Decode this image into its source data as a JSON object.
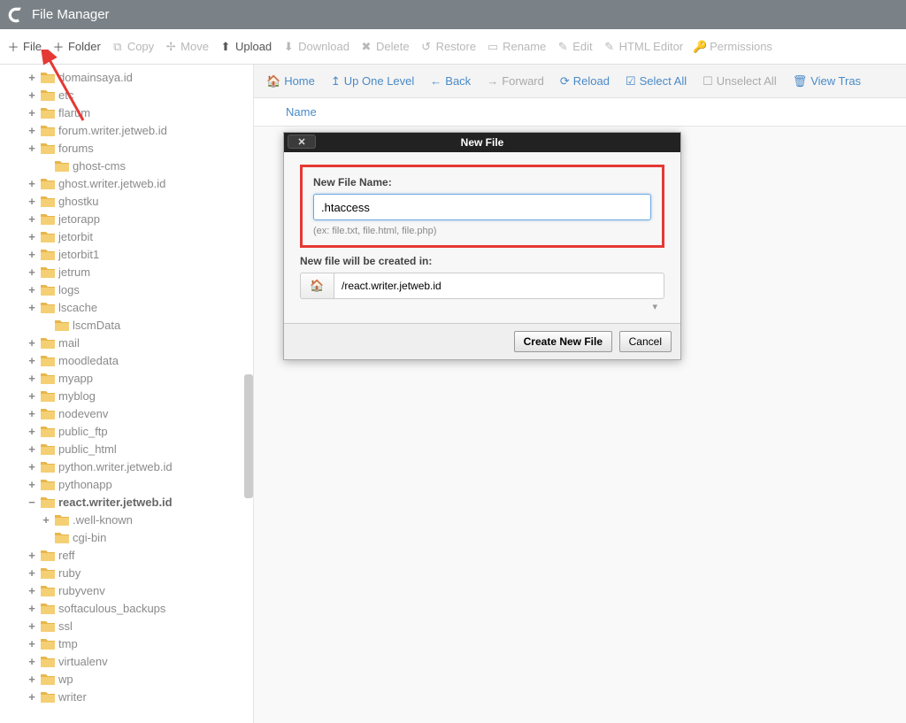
{
  "header": {
    "app_title": "File Manager"
  },
  "toolbar": {
    "file": "File",
    "folder": "Folder",
    "copy": "Copy",
    "move": "Move",
    "upload": "Upload",
    "download": "Download",
    "delete": "Delete",
    "restore": "Restore",
    "rename": "Rename",
    "edit": "Edit",
    "html_editor": "HTML Editor",
    "permissions": "Permissions"
  },
  "actionbar": {
    "home": "Home",
    "up": "Up One Level",
    "back": "Back",
    "forward": "Forward",
    "reload": "Reload",
    "select_all": "Select All",
    "unselect_all": "Unselect All",
    "view_trash": "View Tras"
  },
  "listing": {
    "col_name": "Name"
  },
  "tree": {
    "nodes": [
      {
        "lvl": 1,
        "toggle": "+",
        "label": "domainsaya.id"
      },
      {
        "lvl": 1,
        "toggle": "+",
        "label": "etc"
      },
      {
        "lvl": 1,
        "toggle": "+",
        "label": "flarum"
      },
      {
        "lvl": 1,
        "toggle": "+",
        "label": "forum.writer.jetweb.id"
      },
      {
        "lvl": 1,
        "toggle": "+",
        "label": "forums"
      },
      {
        "lvl": 2,
        "toggle": "",
        "label": "ghost-cms"
      },
      {
        "lvl": 1,
        "toggle": "+",
        "label": "ghost.writer.jetweb.id"
      },
      {
        "lvl": 1,
        "toggle": "+",
        "label": "ghostku"
      },
      {
        "lvl": 1,
        "toggle": "+",
        "label": "jetorapp"
      },
      {
        "lvl": 1,
        "toggle": "+",
        "label": "jetorbit"
      },
      {
        "lvl": 1,
        "toggle": "+",
        "label": "jetorbit1"
      },
      {
        "lvl": 1,
        "toggle": "+",
        "label": "jetrum"
      },
      {
        "lvl": 1,
        "toggle": "+",
        "label": "logs"
      },
      {
        "lvl": 1,
        "toggle": "+",
        "label": "lscache"
      },
      {
        "lvl": 2,
        "toggle": "",
        "label": "lscmData"
      },
      {
        "lvl": 1,
        "toggle": "+",
        "label": "mail"
      },
      {
        "lvl": 1,
        "toggle": "+",
        "label": "moodledata"
      },
      {
        "lvl": 1,
        "toggle": "+",
        "label": "myapp"
      },
      {
        "lvl": 1,
        "toggle": "+",
        "label": "myblog"
      },
      {
        "lvl": 1,
        "toggle": "+",
        "label": "nodevenv"
      },
      {
        "lvl": 1,
        "toggle": "+",
        "label": "public_ftp"
      },
      {
        "lvl": 1,
        "toggle": "+",
        "label": "public_html"
      },
      {
        "lvl": 1,
        "toggle": "+",
        "label": "python.writer.jetweb.id"
      },
      {
        "lvl": 1,
        "toggle": "+",
        "label": "pythonapp"
      },
      {
        "lvl": 1,
        "toggle": "−",
        "label": "react.writer.jetweb.id",
        "active": true
      },
      {
        "lvl": 2,
        "toggle": "+",
        "label": ".well-known"
      },
      {
        "lvl": 2,
        "toggle": "",
        "label": "cgi-bin"
      },
      {
        "lvl": 1,
        "toggle": "+",
        "label": "reff"
      },
      {
        "lvl": 1,
        "toggle": "+",
        "label": "ruby"
      },
      {
        "lvl": 1,
        "toggle": "+",
        "label": "rubyvenv"
      },
      {
        "lvl": 1,
        "toggle": "+",
        "label": "softaculous_backups"
      },
      {
        "lvl": 1,
        "toggle": "+",
        "label": "ssl"
      },
      {
        "lvl": 1,
        "toggle": "+",
        "label": "tmp"
      },
      {
        "lvl": 1,
        "toggle": "+",
        "label": "virtualenv"
      },
      {
        "lvl": 1,
        "toggle": "+",
        "label": "wp"
      },
      {
        "lvl": 1,
        "toggle": "+",
        "label": "writer"
      }
    ]
  },
  "dialog": {
    "title": "New File",
    "filename_label": "New File Name:",
    "filename_value": ".htaccess",
    "filename_hint": "(ex: file.txt, file.html, file.php)",
    "location_label": "New file will be created in:",
    "location_value": "/react.writer.jetweb.id",
    "create_btn": "Create New File",
    "cancel_btn": "Cancel"
  }
}
